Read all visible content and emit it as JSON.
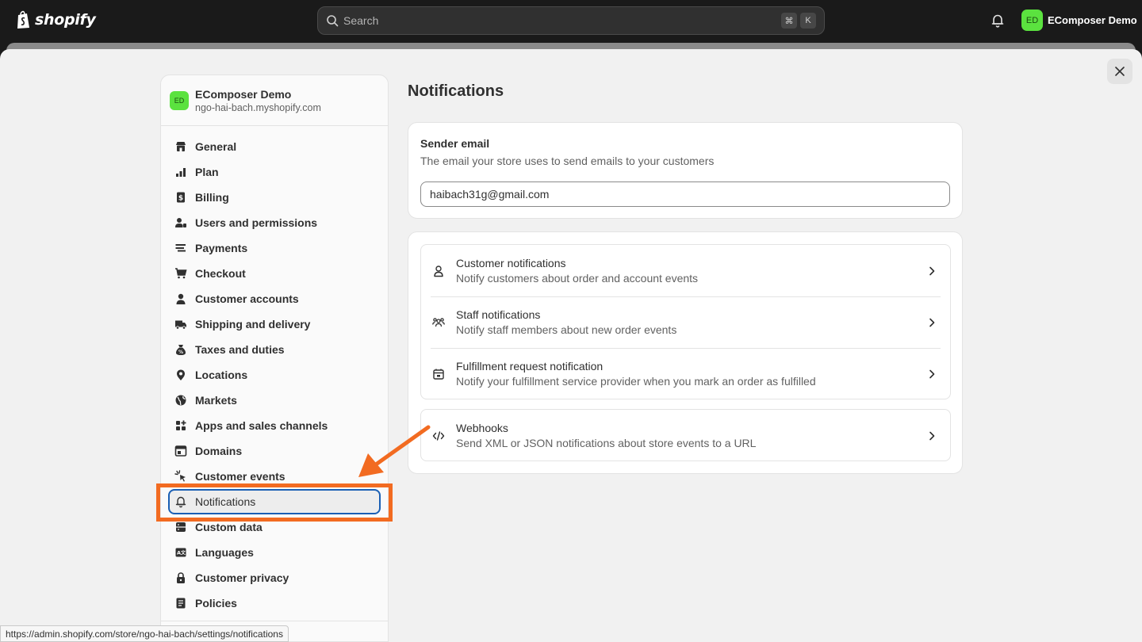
{
  "topbar": {
    "logo_text": "shopify",
    "search_placeholder": "Search",
    "shortcut_keys": [
      "⌘",
      "K"
    ],
    "store_initials": "ED",
    "store_name": "EComposer Demo"
  },
  "sidebar": {
    "store_initials": "ED",
    "store_name": "EComposer Demo",
    "store_domain": "ngo-hai-bach.myshopify.com",
    "items": [
      {
        "label": "General",
        "icon": "store-icon"
      },
      {
        "label": "Plan",
        "icon": "plan-icon"
      },
      {
        "label": "Billing",
        "icon": "billing-icon"
      },
      {
        "label": "Users and permissions",
        "icon": "users-icon"
      },
      {
        "label": "Payments",
        "icon": "payments-icon"
      },
      {
        "label": "Checkout",
        "icon": "cart-icon"
      },
      {
        "label": "Customer accounts",
        "icon": "person-icon"
      },
      {
        "label": "Shipping and delivery",
        "icon": "truck-icon"
      },
      {
        "label": "Taxes and duties",
        "icon": "tax-icon"
      },
      {
        "label": "Locations",
        "icon": "location-icon"
      },
      {
        "label": "Markets",
        "icon": "globe-icon"
      },
      {
        "label": "Apps and sales channels",
        "icon": "apps-icon"
      },
      {
        "label": "Domains",
        "icon": "domains-icon"
      },
      {
        "label": "Customer events",
        "icon": "cursor-icon"
      },
      {
        "label": "Notifications",
        "icon": "bell-icon",
        "active": true
      },
      {
        "label": "Custom data",
        "icon": "database-icon"
      },
      {
        "label": "Languages",
        "icon": "language-icon"
      },
      {
        "label": "Customer privacy",
        "icon": "lock-icon"
      },
      {
        "label": "Policies",
        "icon": "policy-icon"
      }
    ]
  },
  "main": {
    "title": "Notifications",
    "sender": {
      "title": "Sender email",
      "description": "The email your store uses to send emails to your customers",
      "value": "haibach31g@gmail.com"
    },
    "notification_rows": [
      {
        "title": "Customer notifications",
        "description": "Notify customers about order and account events",
        "icon": "person-icon"
      },
      {
        "title": "Staff notifications",
        "description": "Notify staff members about new order events",
        "icon": "team-icon"
      },
      {
        "title": "Fulfillment request notification",
        "description": "Notify your fulfillment service provider when you mark an order as fulfilled",
        "icon": "package-icon"
      }
    ],
    "webhooks": {
      "title": "Webhooks",
      "description": "Send XML or JSON notifications about store events to a URL",
      "icon": "code-icon"
    }
  },
  "status_url": "https://admin.shopify.com/store/ngo-hai-bach/settings/notifications",
  "colors": {
    "accent_highlight": "#f26b21",
    "brand_green": "#5be23f",
    "focus_blue": "#1a5fb4"
  }
}
